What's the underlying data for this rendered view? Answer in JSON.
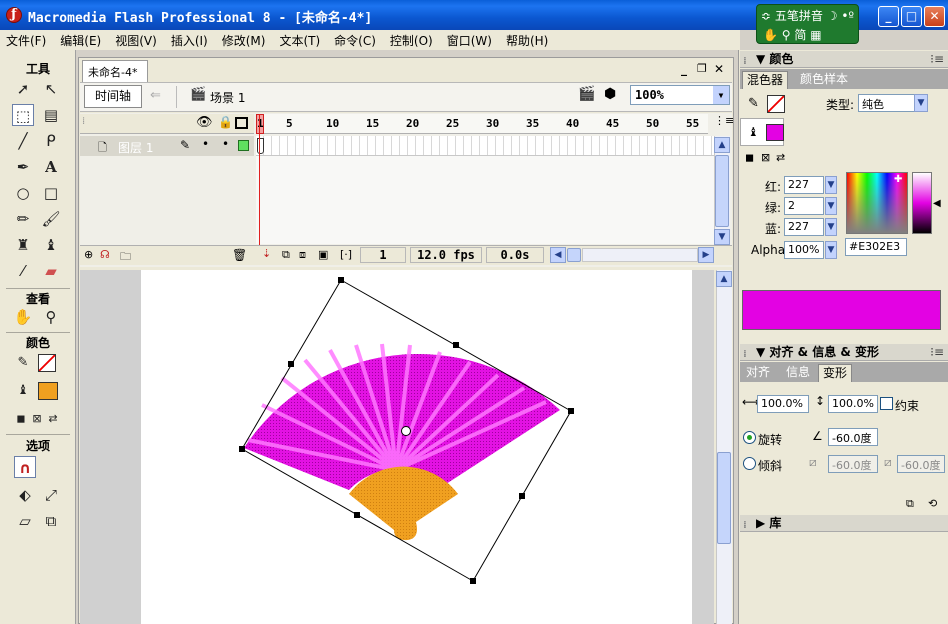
{
  "window": {
    "title": "Macromedia Flash Professional 8 - [未命名-4*]",
    "min": "_",
    "max": "□",
    "close": "✕"
  },
  "ime": {
    "name": "五笔拼音",
    "mode": "简"
  },
  "menu": [
    "文件(F)",
    "编辑(E)",
    "视图(V)",
    "插入(I)",
    "修改(M)",
    "文本(T)",
    "命令(C)",
    "控制(O)",
    "窗口(W)",
    "帮助(H)"
  ],
  "tools": {
    "title": "工具",
    "view": "查看",
    "colors": "颜色",
    "options": "选项",
    "fill_color": "#f0a020"
  },
  "document": {
    "tab": "未命名-4*",
    "timeline_button": "时间轴",
    "scene": "场景 1",
    "zoom": "100%"
  },
  "timeline": {
    "ruler": [
      "1",
      "5",
      "10",
      "15",
      "20",
      "25",
      "30",
      "35",
      "40",
      "45",
      "50",
      "55"
    ],
    "layer_name": "图层 1",
    "current_frame": "1",
    "fps": "12.0 fps",
    "elapsed": "0.0s"
  },
  "color_panel": {
    "title": "颜色",
    "tab_mixer": "混色器",
    "tab_swatches": "颜色样本",
    "type_label": "类型:",
    "type_value": "纯色",
    "red_label": "红:",
    "red": "227",
    "green_label": "绿:",
    "green": "2",
    "blue_label": "蓝:",
    "blue": "227",
    "alpha_label": "Alpha:",
    "alpha": "100%",
    "hex": "#E302E3",
    "swatch_color": "#E302E3"
  },
  "align_panel": {
    "title": "对齐 & 信息 & 变形",
    "tab_align": "对齐",
    "tab_info": "信息",
    "tab_transform": "变形",
    "scale_w": "100.0%",
    "scale_h": "100.0%",
    "constrain": "约束",
    "rotate_label": "旋转",
    "rotate_value": "-60.0度",
    "skew_label": "倾斜",
    "skew_h": "-60.0度",
    "skew_v": "-60.0度"
  },
  "library_panel": {
    "title": "库"
  }
}
